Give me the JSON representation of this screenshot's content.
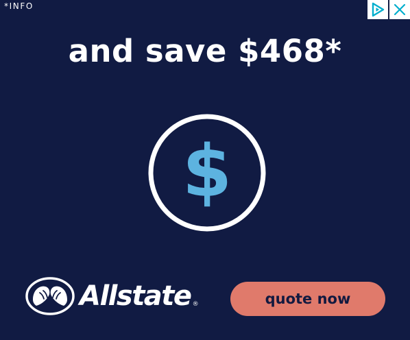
{
  "ad": {
    "info_label": "*INFO",
    "headline": "and save $468*",
    "dollar_symbol": "$",
    "brand_name": "Allstate",
    "registered_mark": "®",
    "cta_label": "quote now",
    "icons": {
      "adchoices": "adchoices-play-icon",
      "close": "close-icon",
      "hands_logo": "allstate-hands-logo-icon",
      "dollar": "dollar-circle-icon"
    },
    "colors": {
      "background": "#111b43",
      "dollar_blue": "#5db3e0",
      "cta_background": "#e07a6b",
      "cta_text": "#131a40",
      "adchoices_blue": "#00aecd"
    }
  }
}
